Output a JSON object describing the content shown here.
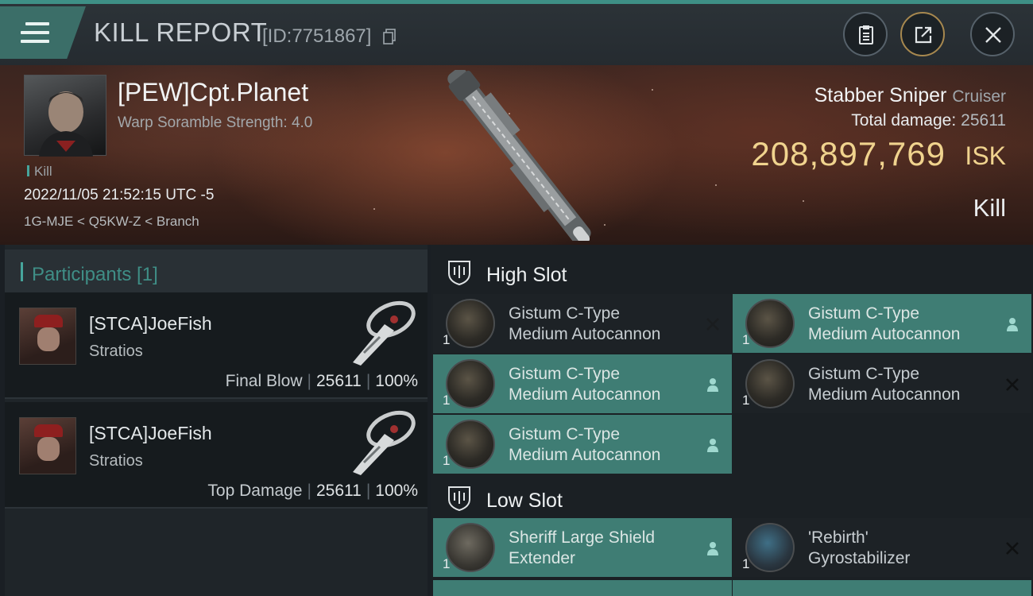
{
  "header": {
    "title": "KILL REPORT",
    "report_id": "[ID:7751867]"
  },
  "victim": {
    "name": "[PEW]Cpt.Planet",
    "subtitle": "Warp Soramble Strength: 4.0",
    "tag": "Kill",
    "timestamp": "2022/11/05 21:52:15 UTC -5",
    "location": "1G-MJE < Q5KW-Z < Branch",
    "ship": "Stabber Sniper",
    "ship_class": "Cruiser",
    "total_damage_label": "Total damage:",
    "total_damage": "25611",
    "isk_value": "208,897,769",
    "isk_unit": "ISK",
    "result": "Kill"
  },
  "participants": {
    "title": "Participants [1]",
    "items": [
      {
        "name": "[STCA]JoeFish",
        "ship": "Stratios",
        "role": "Final Blow",
        "damage": "25611",
        "percent": "100%"
      },
      {
        "name": "[STCA]JoeFish",
        "ship": "Stratios",
        "role": "Top Damage",
        "damage": "25611",
        "percent": "100%"
      }
    ]
  },
  "slots": {
    "high": {
      "label": "High Slot",
      "modules": [
        {
          "qty": "1",
          "line1": "Gistum C-Type",
          "line2": "Medium Autocannon",
          "status": "destroyed"
        },
        {
          "qty": "1",
          "line1": "Gistum C-Type",
          "line2": "Medium Autocannon",
          "status": "dropped"
        },
        {
          "qty": "1",
          "line1": "Gistum C-Type",
          "line2": "Medium Autocannon",
          "status": "dropped"
        },
        {
          "qty": "1",
          "line1": "Gistum C-Type",
          "line2": "Medium Autocannon",
          "status": "destroyed"
        },
        {
          "qty": "1",
          "line1": "Gistum C-Type",
          "line2": "Medium Autocannon",
          "status": "dropped"
        }
      ]
    },
    "low": {
      "label": "Low Slot",
      "modules": [
        {
          "qty": "1",
          "line1": "Sheriff Large Shield",
          "line2": "Extender",
          "status": "dropped"
        },
        {
          "qty": "1",
          "line1": "'Rebirth'",
          "line2": "Gyrostabilizer",
          "status": "destroyed"
        }
      ]
    }
  },
  "colors": {
    "accent": "#46a59c",
    "dropped": "#3f7d74",
    "isk": "#f0d38e"
  },
  "icons": {
    "menu": "hamburger-icon",
    "copy": "copy-icon",
    "clipboard": "clipboard-icon",
    "share": "share-icon",
    "close": "close-icon",
    "slot": "slot-shield-icon",
    "dropped": "person-icon",
    "destroyed": "x-icon"
  }
}
